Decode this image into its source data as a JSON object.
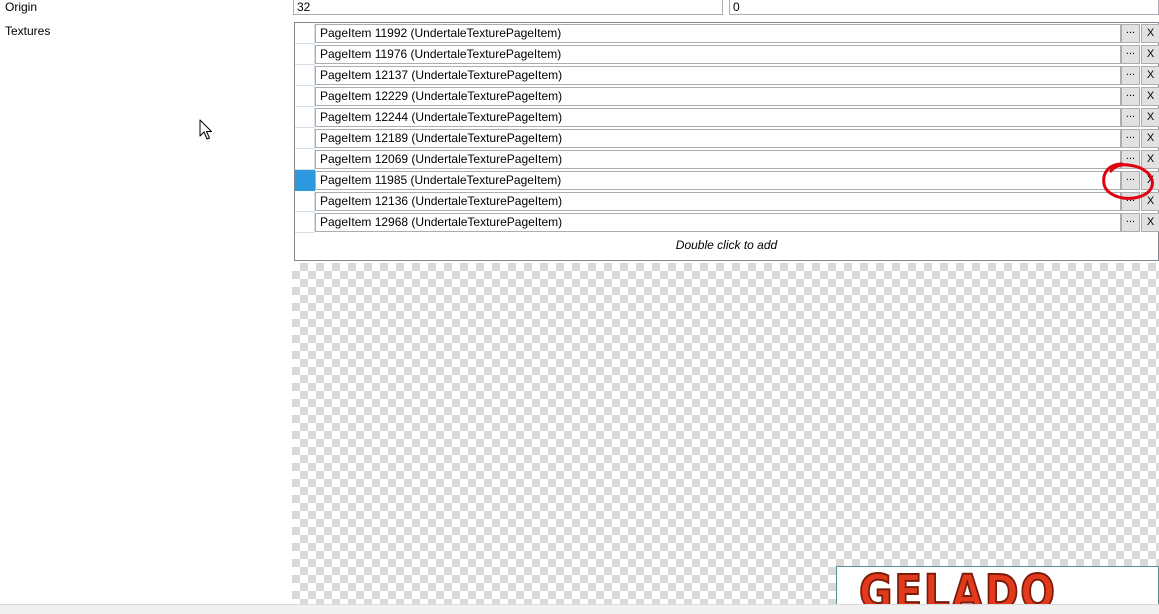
{
  "properties": {
    "origin": {
      "label": "Origin",
      "x": "32",
      "y": "0"
    },
    "textures": {
      "label": "Textures"
    }
  },
  "textures_list": {
    "items": [
      {
        "label": "PageItem 11992 (UndertaleTexturePageItem)"
      },
      {
        "label": "PageItem 11976 (UndertaleTexturePageItem)"
      },
      {
        "label": "PageItem 12137 (UndertaleTexturePageItem)"
      },
      {
        "label": "PageItem 12229 (UndertaleTexturePageItem)"
      },
      {
        "label": "PageItem 12244 (UndertaleTexturePageItem)"
      },
      {
        "label": "PageItem 12189 (UndertaleTexturePageItem)"
      },
      {
        "label": "PageItem 12069 (UndertaleTexturePageItem)"
      },
      {
        "label": "PageItem 11985 (UndertaleTexturePageItem)"
      },
      {
        "label": "PageItem 12136 (UndertaleTexturePageItem)"
      },
      {
        "label": "PageItem 12968 (UndertaleTexturePageItem)"
      }
    ],
    "browse_label": "...",
    "remove_label": "X",
    "add_hint": "Double click to add",
    "selected_index": 7
  },
  "preview": {
    "sprite_text": "GELADO"
  },
  "colors": {
    "selection": "#2c98de",
    "annotation": "#e0000f",
    "checker": "#d9d9d9"
  },
  "icons": {
    "cursor": "arrow-cursor-icon",
    "annotation": "red-circle-annotation"
  }
}
